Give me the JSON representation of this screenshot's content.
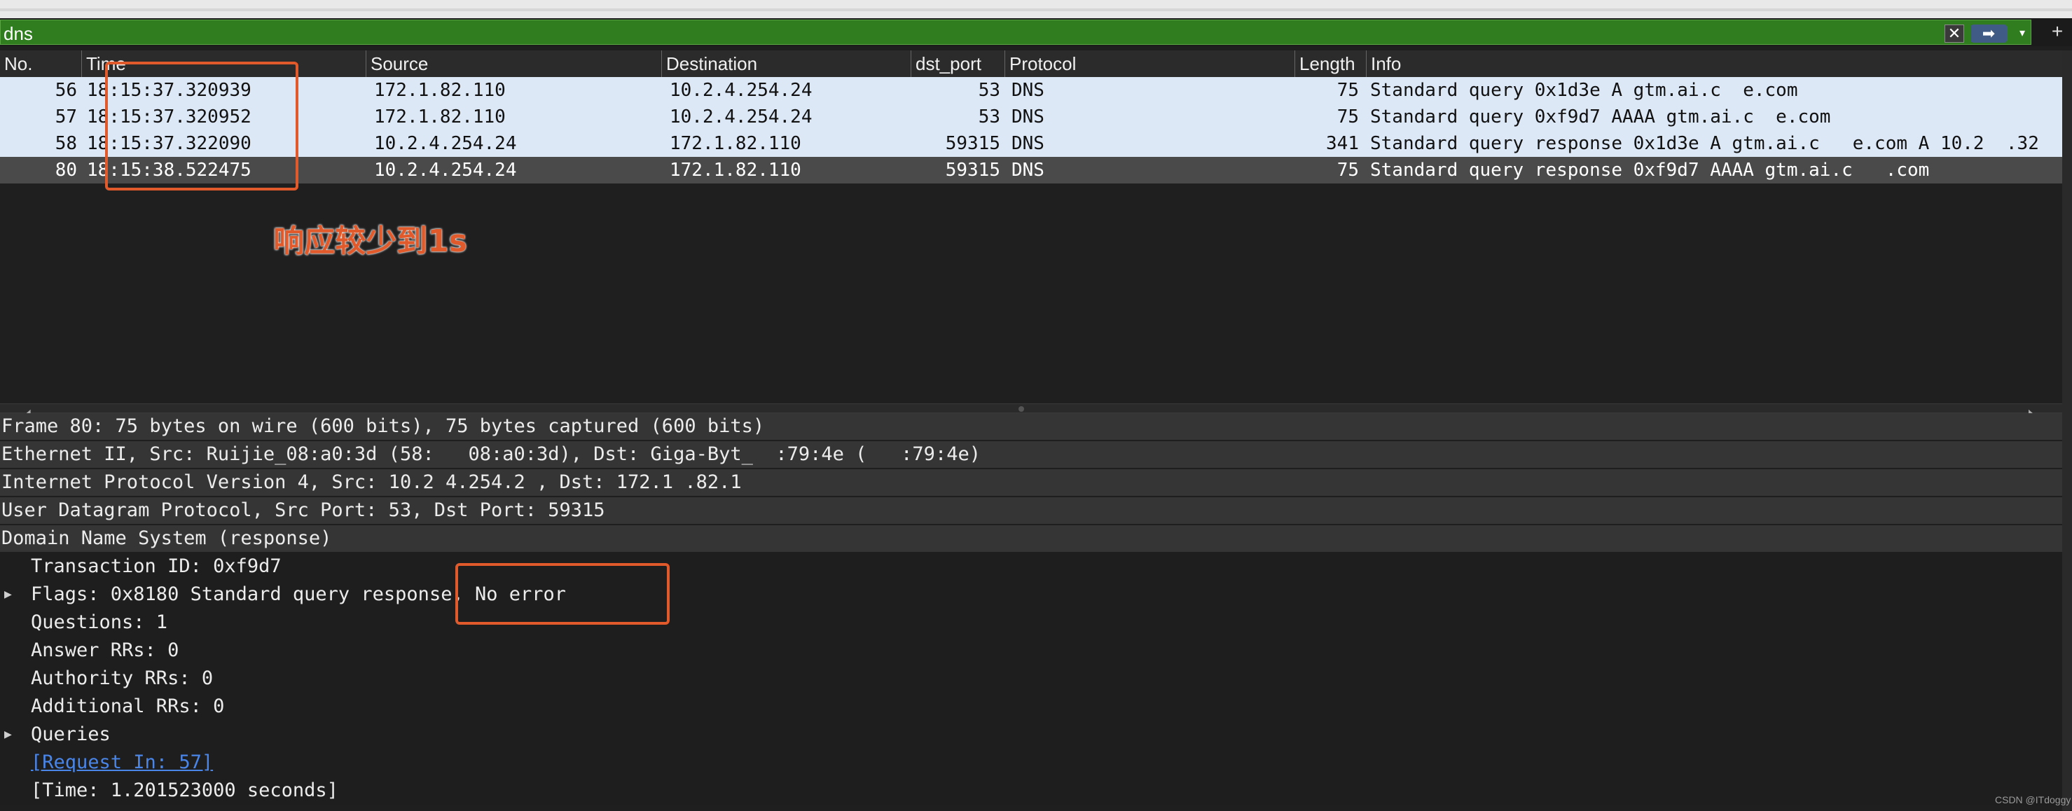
{
  "filter": {
    "text": "dns",
    "clear_icon": "✕",
    "apply_icon": "➡",
    "dropdown_icon": "▾",
    "add_icon": "+"
  },
  "columns": [
    "No.",
    "Time",
    "Source",
    "Destination",
    "dst_port",
    "Protocol",
    "Length",
    "Info"
  ],
  "packets": [
    {
      "no": "56",
      "time": "18:15:37.320939",
      "src": "172.1.82.110",
      "dst": "10.2.4.254.24",
      "port": "53",
      "proto": "DNS",
      "len": "75",
      "info": "Standard query 0x1d3e A gtm.ai.c  e.com"
    },
    {
      "no": "57",
      "time": "18:15:37.320952",
      "src": "172.1.82.110",
      "dst": "10.2.4.254.24",
      "port": "53",
      "proto": "DNS",
      "len": "75",
      "info": "Standard query 0xf9d7 AAAA gtm.ai.c  e.com"
    },
    {
      "no": "58",
      "time": "18:15:37.322090",
      "src": "10.2.4.254.24",
      "dst": "172.1.82.110",
      "port": "59315",
      "proto": "DNS",
      "len": "341",
      "info": "Standard query response 0x1d3e A gtm.ai.c   e.com A 10.2  .32"
    },
    {
      "no": "80",
      "time": "18:15:38.522475",
      "src": "10.2.4.254.24",
      "dst": "172.1.82.110",
      "port": "59315",
      "proto": "DNS",
      "len": "75",
      "info": "Standard query response 0xf9d7 AAAA gtm.ai.c   .com"
    }
  ],
  "annotation": {
    "label": "响应较少到1s"
  },
  "details": {
    "frame": "Frame 80: 75 bytes on wire (600 bits), 75 bytes captured (600 bits)",
    "ethernet": "Ethernet II, Src: Ruijie_08:a0:3d (58:   08:a0:3d), Dst: Giga-Byt_  :79:4e (   :79:4e)",
    "ip": "Internet Protocol Version 4, Src: 10.2 4.254.2 , Dst: 172.1 .82.1",
    "udp": "User Datagram Protocol, Src Port: 53, Dst Port: 59315",
    "dns": "Domain Name System (response)",
    "transaction_id": "Transaction ID: 0xf9d7",
    "flags": "Flags: 0x8180 Standard query response, No error",
    "questions": "Questions: 1",
    "answer_rrs": "Answer RRs: 0",
    "authority_rrs": "Authority RRs: 0",
    "additional_rrs": "Additional RRs: 0",
    "queries": "Queries",
    "request_in": "[Request In: 57]",
    "time": "[Time: 1.201523000 seconds]"
  },
  "watermark": "CSDN @ITdoggy"
}
